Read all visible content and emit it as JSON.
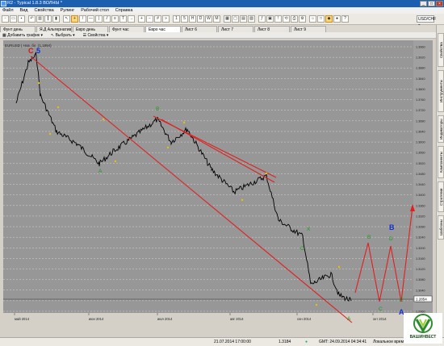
{
  "window": {
    "title": "R2 - Typical 1.8.3 ВОЛНЫ *"
  },
  "menu": [
    "Файл",
    "Вид",
    "Свойства",
    "Рулинг",
    "Рабочий стол",
    "Справка"
  ],
  "toolbar": {
    "symbol": "USD/CHF"
  },
  "tabs": [
    "Фунт день",
    "Я.Д Альтернатива",
    "Евро день",
    "Фунт час",
    "Евро час",
    "Лист 6",
    "Лист 7",
    "Лист 8",
    "Лист 9"
  ],
  "active_tab": "Евро час",
  "subtoolbar": {
    "add_chart": "Добавить график",
    "select": "Выбрать",
    "properties": "Свойства"
  },
  "chart_header": "EURUSD | Нов. бл. (1,1894)",
  "right_panels": [
    "Свойства",
    "Инструменты",
    "Индикаторы",
    "Компоненты",
    "Стратегии",
    "Шаблоны"
  ],
  "chart_data": {
    "type": "line",
    "x_labels": [
      "май 2014",
      "июн 2014",
      "июл 2014",
      "авг 2014",
      "сен 2014",
      "окт 2014"
    ],
    "y_ticks": [
      1.296,
      1.3,
      1.304,
      1.308,
      1.312,
      1.316,
      1.32,
      1.324,
      1.328,
      1.332,
      1.336,
      1.34,
      1.344,
      1.348,
      1.352,
      1.356,
      1.36,
      1.364,
      1.368,
      1.372,
      1.376,
      1.38,
      1.384,
      1.388,
      1.392,
      1.396
    ],
    "current_price_label": "1.2854",
    "wave_labels": [
      {
        "text": "C",
        "color": "#e01010",
        "big": true
      },
      {
        "text": "5",
        "color": "#1030d0",
        "big": true
      },
      {
        "text": "A",
        "color": "#1a9a1a"
      },
      {
        "text": "B",
        "color": "#1a9a1a"
      },
      {
        "text": "C",
        "color": "#1a9a1a"
      },
      {
        "text": "X",
        "color": "#1a9a1a"
      },
      {
        "text": "A",
        "color": "#1a9a1a"
      },
      {
        "text": "B",
        "color": "#1a9a1a"
      },
      {
        "text": "C",
        "color": "#1a9a1a"
      },
      {
        "text": "D",
        "color": "#1a9a1a"
      },
      {
        "text": "E",
        "color": "#1a9a1a"
      },
      {
        "text": "A",
        "color": "#1030d0",
        "big": true
      },
      {
        "text": "B",
        "color": "#1030d0",
        "big": true
      }
    ]
  },
  "status": {
    "datetime": "21.07.2014 17:00:00",
    "price": "1.3184",
    "gmt": "GMT: 24.09.2014 04:34:41",
    "local": "Локальное время: 24"
  },
  "logo": {
    "text": "ВАШИНВЕСТ"
  }
}
